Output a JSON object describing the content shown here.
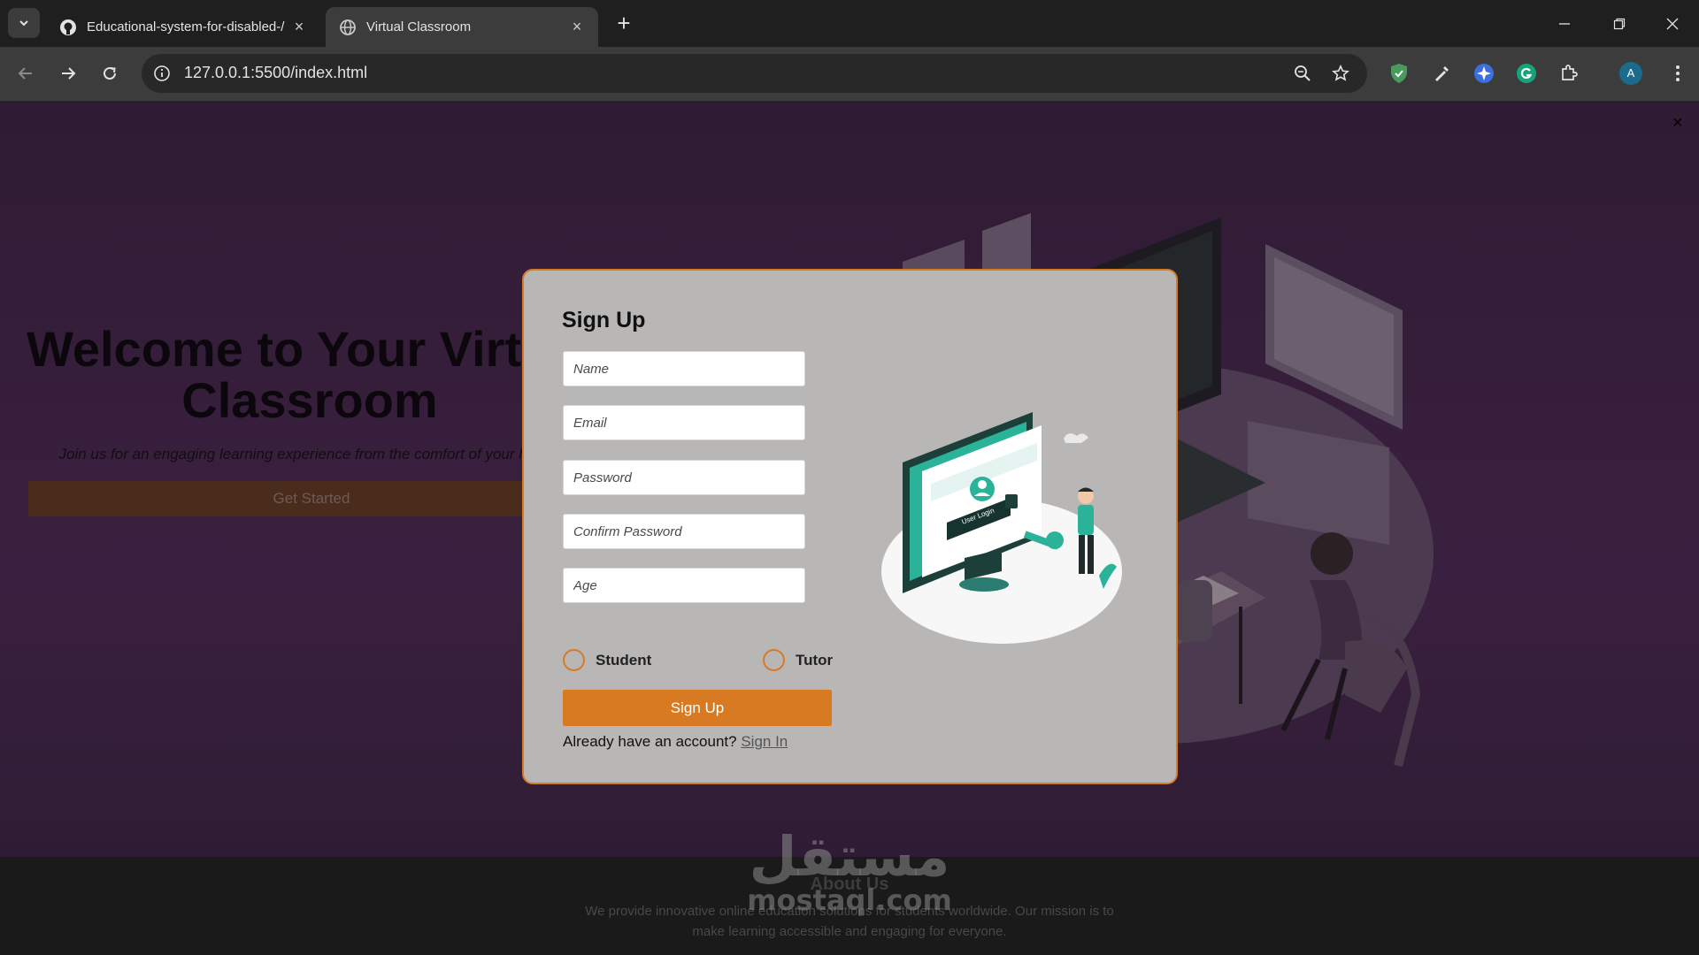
{
  "browser": {
    "tabs": [
      {
        "title": "Educational-system-for-disabled-/",
        "icon": "github-icon",
        "active": false
      },
      {
        "title": "Virtual Classroom",
        "icon": "globe-icon",
        "active": true
      }
    ],
    "url": "127.0.0.1:5500/index.html",
    "profile_initial": "A"
  },
  "page": {
    "hero": {
      "title": "Welcome to Your Virtual Classroom",
      "subtitle": "Join us for an engaging learning experience from the comfort of your home.",
      "cta_label": "Get Started"
    },
    "footer": {
      "heading": "About Us",
      "text": "We provide innovative online education solutions for students worldwide. Our mission is to make learning accessible and engaging for everyone."
    },
    "watermark": {
      "arabic": "مستقل",
      "latin": "mostaql.com"
    },
    "close_glyph": "×"
  },
  "signup_modal": {
    "title": "Sign Up",
    "fields": {
      "name_placeholder": "Name",
      "email_placeholder": "Email",
      "password_placeholder": "Password",
      "confirm_placeholder": "Confirm Password",
      "age_placeholder": "Age"
    },
    "roles": {
      "student": "Student",
      "tutor": "Tutor"
    },
    "submit_label": "Sign Up",
    "signin_prompt": "Already have an account?",
    "signin_link": "Sign In",
    "image_label": "User Login"
  },
  "colors": {
    "accent": "#d87a22",
    "modal_bg": "#b9b7b5",
    "page_bg": "#3a2040",
    "illustration_teal": "#2bb39a"
  }
}
